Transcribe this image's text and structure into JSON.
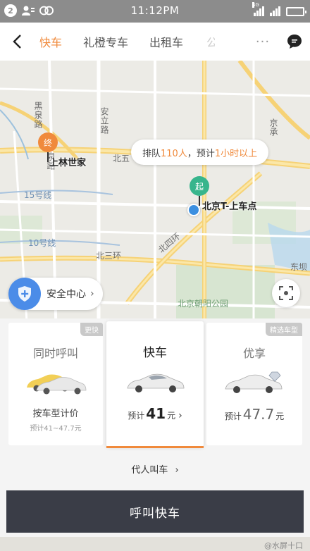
{
  "status_bar": {
    "notification_count": "2",
    "time": "11:12PM",
    "network_label": "4G"
  },
  "nav": {
    "tabs": [
      {
        "label": "快车",
        "active": true
      },
      {
        "label": "礼橙专车",
        "active": false
      },
      {
        "label": "出租车",
        "active": false
      },
      {
        "label": "公",
        "active": false
      }
    ],
    "more_label": "···"
  },
  "map": {
    "labels": {
      "heiquan_road": "黑泉路",
      "anli_road": "安立路",
      "jingcheng": "京承",
      "north_fifth_ring": "北五",
      "line15": "15号线",
      "line10": "10号线",
      "north_fourth_ring": "北四环",
      "north_third_ring": "北三环",
      "dongfeng": "东坝",
      "chaoyang_park": "北京朝阳公园",
      "heiquan_short": "泉路"
    },
    "end_pin": {
      "glyph": "终",
      "label": "上林世家"
    },
    "start_pin": {
      "glyph": "起",
      "label": "北京T-上车点"
    },
    "queue_bubble": {
      "prefix": "排队",
      "count": "110人",
      "middle": "，预计",
      "duration": "1小时以上"
    },
    "safety_center": {
      "label": "安全中心",
      "chevron": "›"
    }
  },
  "cards": [
    {
      "name": "同时呼叫",
      "badge": "更快",
      "line1": "按车型计价",
      "line2": "预计41~47.7元"
    },
    {
      "name": "快车",
      "price_prefix": "预计",
      "price": "41",
      "price_unit": "元",
      "chevron": "›"
    },
    {
      "name": "优享",
      "badge": "精选车型",
      "price_prefix": "预计",
      "price": "47.7",
      "price_unit": "元"
    }
  ],
  "proxy_call": {
    "label": "代人叫车",
    "chevron": "›"
  },
  "call_button": {
    "label": "呼叫快车"
  },
  "watermark": "@水屏十口",
  "colors": {
    "accent": "#f08a3c",
    "start_green": "#37b58c",
    "button_dark": "#3a3d47",
    "location_blue": "#3b8fe0"
  }
}
